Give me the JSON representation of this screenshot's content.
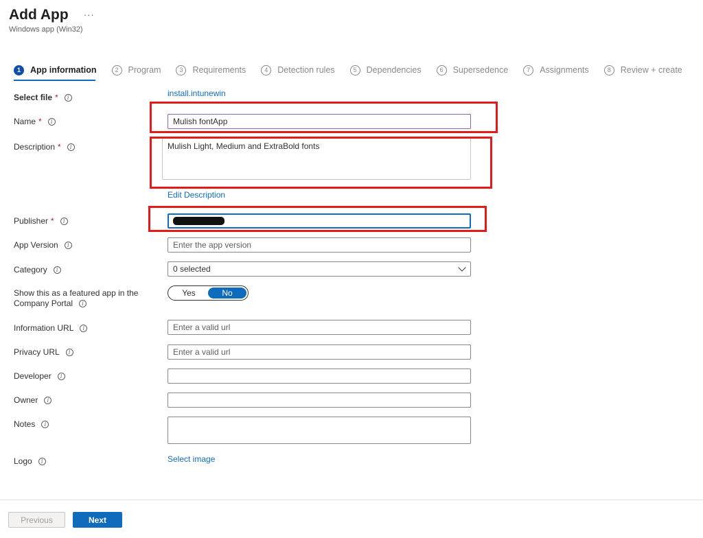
{
  "header": {
    "title": "Add App",
    "subtitle": "Windows app (Win32)",
    "more_label": "···"
  },
  "steps": [
    {
      "num": "1",
      "label": "App information"
    },
    {
      "num": "2",
      "label": "Program"
    },
    {
      "num": "3",
      "label": "Requirements"
    },
    {
      "num": "4",
      "label": "Detection rules"
    },
    {
      "num": "5",
      "label": "Dependencies"
    },
    {
      "num": "6",
      "label": "Supersedence"
    },
    {
      "num": "7",
      "label": "Assignments"
    },
    {
      "num": "8",
      "label": "Review + create"
    }
  ],
  "form": {
    "select_file": {
      "label": "Select file",
      "required": "*",
      "value": "install.intunewin"
    },
    "name": {
      "label": "Name",
      "required": "*",
      "value": "Mulish fontApp"
    },
    "description": {
      "label": "Description",
      "required": "*",
      "value": "Mulish Light, Medium and ExtraBold fonts",
      "edit_link": "Edit Description"
    },
    "publisher": {
      "label": "Publisher",
      "required": "*"
    },
    "app_version": {
      "label": "App Version",
      "placeholder": "Enter the app version"
    },
    "category": {
      "label": "Category",
      "value": "0 selected"
    },
    "featured": {
      "label_line1": "Show this as a featured app in the",
      "label_line2": "Company Portal",
      "yes": "Yes",
      "no": "No"
    },
    "information_url": {
      "label": "Information URL",
      "placeholder": "Enter a valid url"
    },
    "privacy_url": {
      "label": "Privacy URL",
      "placeholder": "Enter a valid url"
    },
    "developer": {
      "label": "Developer"
    },
    "owner": {
      "label": "Owner"
    },
    "notes": {
      "label": "Notes"
    },
    "logo": {
      "label": "Logo",
      "link": "Select image"
    }
  },
  "footer": {
    "previous": "Previous",
    "next": "Next"
  },
  "colors": {
    "accent": "#0f6cbd",
    "annotation": "#e11a1a",
    "required": "#a4262c"
  }
}
